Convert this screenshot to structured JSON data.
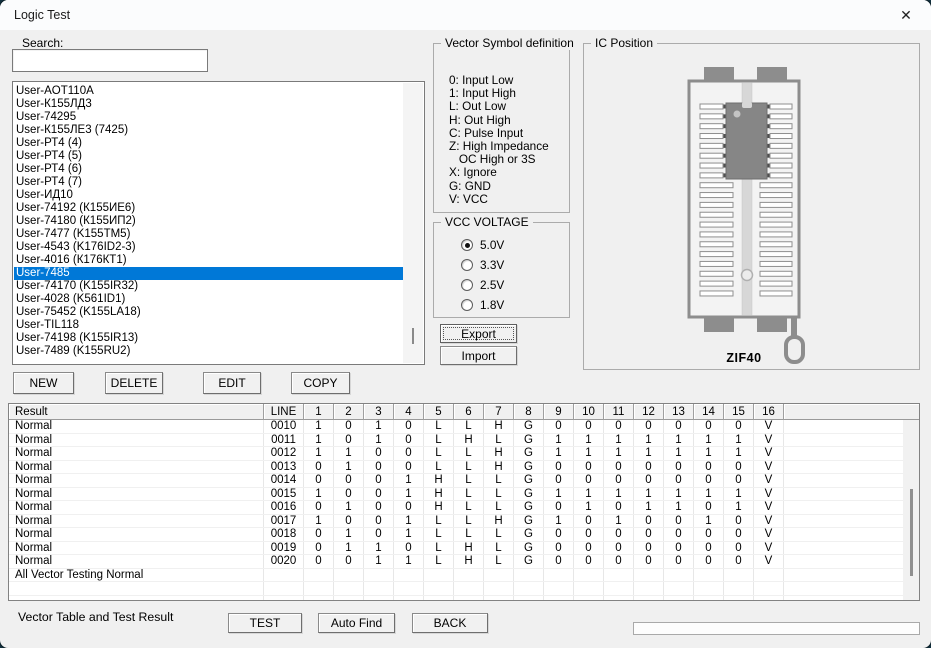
{
  "window": {
    "title": "Logic Test",
    "close_icon": "✕"
  },
  "search": {
    "label": "Search:",
    "value": ""
  },
  "device_list": {
    "selected_index": 14,
    "items": [
      "User-AOT110A",
      "User-К155ЛД3",
      "User-74295",
      "User-К155ЛЕ3 (7425)",
      "User-РТ4 (4)",
      "User-РТ4 (5)",
      "User-РТ4 (6)",
      "User-РТ4 (7)",
      "User-ИД10",
      "User-74192 (К155ИЕ6)",
      "User-74180 (К155ИП2)",
      "User-7477 (K155TM5)",
      "User-4543 (K176ID2-3)",
      "User-4016 (К176КТ1)",
      "User-7485",
      "User-74170 (K155IR32)",
      "User-4028 (K561ID1)",
      "User-75452 (K155LA18)",
      "User-TIL118",
      "User-74198 (K155IR13)",
      "User-7489 (K155RU2)"
    ]
  },
  "list_buttons": {
    "new": "NEW",
    "delete": "DELETE",
    "edit": "EDIT",
    "copy": "COPY"
  },
  "vector_symbols": {
    "title": "Vector Symbol definition",
    "lines": [
      "0: Input Low",
      "1: Input High",
      "L: Out Low",
      "H: Out High",
      "C: Pulse Input",
      "Z: High Impedance",
      "   OC High or 3S",
      "X: Ignore",
      "G: GND",
      "V: VCC"
    ]
  },
  "vcc_voltage": {
    "title": "VCC VOLTAGE",
    "options": [
      {
        "label": "5.0V",
        "selected": true
      },
      {
        "label": "3.3V",
        "selected": false
      },
      {
        "label": "2.5V",
        "selected": false
      },
      {
        "label": "1.8V",
        "selected": false
      }
    ]
  },
  "io_buttons": {
    "export": "Export",
    "import": "Import"
  },
  "ic_position": {
    "title": "IC Position",
    "socket_label": "ZIF40"
  },
  "result_table": {
    "columns": [
      "Result",
      "LINE",
      "1",
      "2",
      "3",
      "4",
      "5",
      "6",
      "7",
      "8",
      "9",
      "10",
      "11",
      "12",
      "13",
      "14",
      "15",
      "16"
    ],
    "rows": [
      {
        "result": "Normal",
        "line": "0010",
        "values": [
          "1",
          "0",
          "1",
          "0",
          "L",
          "L",
          "H",
          "G",
          "0",
          "0",
          "0",
          "0",
          "0",
          "0",
          "0",
          "V"
        ]
      },
      {
        "result": "Normal",
        "line": "0011",
        "values": [
          "1",
          "0",
          "1",
          "0",
          "L",
          "H",
          "L",
          "G",
          "1",
          "1",
          "1",
          "1",
          "1",
          "1",
          "1",
          "V"
        ]
      },
      {
        "result": "Normal",
        "line": "0012",
        "values": [
          "1",
          "1",
          "0",
          "0",
          "L",
          "L",
          "H",
          "G",
          "1",
          "1",
          "1",
          "1",
          "1",
          "1",
          "1",
          "V"
        ]
      },
      {
        "result": "Normal",
        "line": "0013",
        "values": [
          "0",
          "1",
          "0",
          "0",
          "L",
          "L",
          "H",
          "G",
          "0",
          "0",
          "0",
          "0",
          "0",
          "0",
          "0",
          "V"
        ]
      },
      {
        "result": "Normal",
        "line": "0014",
        "values": [
          "0",
          "0",
          "0",
          "1",
          "H",
          "L",
          "L",
          "G",
          "0",
          "0",
          "0",
          "0",
          "0",
          "0",
          "0",
          "V"
        ]
      },
      {
        "result": "Normal",
        "line": "0015",
        "values": [
          "1",
          "0",
          "0",
          "1",
          "H",
          "L",
          "L",
          "G",
          "1",
          "1",
          "1",
          "1",
          "1",
          "1",
          "1",
          "V"
        ]
      },
      {
        "result": "Normal",
        "line": "0016",
        "values": [
          "0",
          "1",
          "0",
          "0",
          "H",
          "L",
          "L",
          "G",
          "0",
          "1",
          "0",
          "1",
          "1",
          "0",
          "1",
          "V"
        ]
      },
      {
        "result": "Normal",
        "line": "0017",
        "values": [
          "1",
          "0",
          "0",
          "1",
          "L",
          "L",
          "H",
          "G",
          "1",
          "0",
          "1",
          "0",
          "0",
          "1",
          "0",
          "V"
        ]
      },
      {
        "result": "Normal",
        "line": "0018",
        "values": [
          "0",
          "1",
          "0",
          "1",
          "L",
          "L",
          "L",
          "G",
          "0",
          "0",
          "0",
          "0",
          "0",
          "0",
          "0",
          "V"
        ]
      },
      {
        "result": "Normal",
        "line": "0019",
        "values": [
          "0",
          "1",
          "1",
          "0",
          "L",
          "H",
          "L",
          "G",
          "0",
          "0",
          "0",
          "0",
          "0",
          "0",
          "0",
          "V"
        ]
      },
      {
        "result": "Normal",
        "line": "0020",
        "values": [
          "0",
          "0",
          "1",
          "1",
          "L",
          "H",
          "L",
          "G",
          "0",
          "0",
          "0",
          "0",
          "0",
          "0",
          "0",
          "V"
        ]
      }
    ],
    "summary": "All Vector Testing Normal"
  },
  "footer": {
    "status": "Vector Table and Test Result",
    "test": "TEST",
    "auto_find": "Auto Find",
    "back": "BACK"
  },
  "colors": {
    "selection": "#0078d7",
    "chip_gray": "#868686",
    "socket_gray": "#8d8d8d"
  }
}
